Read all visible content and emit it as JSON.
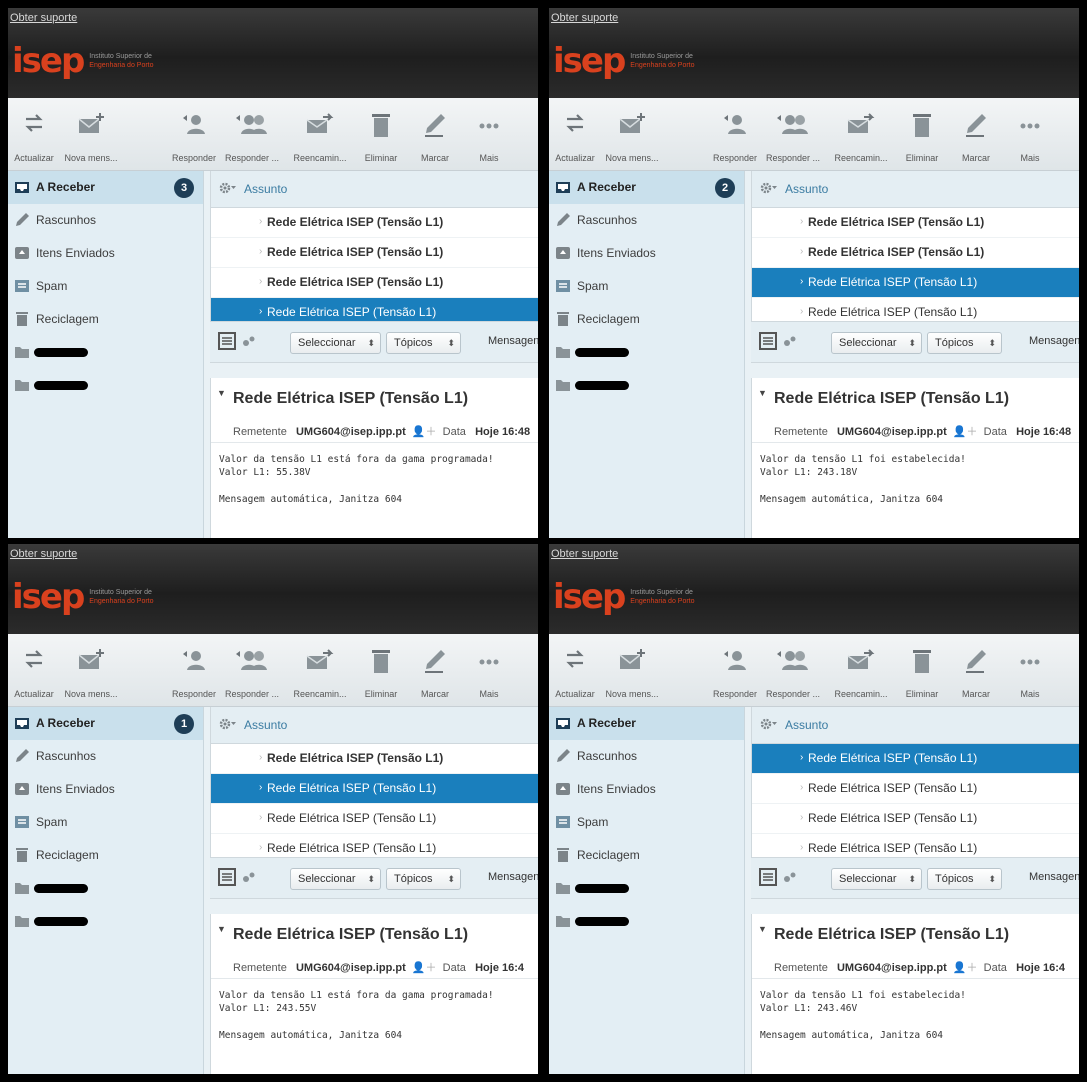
{
  "header": {
    "support_link": "Obter suporte",
    "logo_mark": "isep",
    "logo_line1": "Instituto Superior de",
    "logo_line2": "Engenharia do Porto"
  },
  "toolbar": {
    "refresh": "Actualizar",
    "new_message": "Nova mens...",
    "reply": "Responder",
    "reply_all": "Responder ...",
    "forward": "Reencamin...",
    "delete": "Eliminar",
    "mark": "Marcar",
    "more": "Mais"
  },
  "sidebar": {
    "inbox": "A Receber",
    "drafts": "Rascunhos",
    "sent": "Itens Enviados",
    "spam": "Spam",
    "trash": "Reciclagem"
  },
  "list": {
    "header": "Assunto",
    "subject": "Rede Elétrica ISEP (Tensão L1)",
    "select_label": "Seleccionar",
    "topics_label": "Tópicos",
    "messages_label": "Mensagens"
  },
  "preview": {
    "title": "Rede Elétrica ISEP (Tensão L1)",
    "sender_label": "Remetente",
    "sender": "UMG604@isep.ipp.pt",
    "date_label": "Data",
    "signature": "Mensagem automática, Janitza 604"
  },
  "panels": [
    {
      "inbox_count": "3",
      "date_value": "Hoje 16:48",
      "body_line1": "Valor da tensão L1 está fora da gama programada!",
      "body_line2": "Valor L1: 55.38V",
      "rows": [
        {
          "unread": true,
          "selected": false
        },
        {
          "unread": true,
          "selected": false
        },
        {
          "unread": true,
          "selected": false
        },
        {
          "unread": false,
          "selected": true
        }
      ]
    },
    {
      "inbox_count": "2",
      "date_value": "Hoje 16:48",
      "body_line1": "Valor da tensão L1 foi estabelecida!",
      "body_line2": "Valor L1: 243.18V",
      "rows": [
        {
          "unread": true,
          "selected": false
        },
        {
          "unread": true,
          "selected": false
        },
        {
          "unread": false,
          "selected": true
        },
        {
          "unread": false,
          "selected": false
        }
      ]
    },
    {
      "inbox_count": "1",
      "date_value": "Hoje 16:4",
      "body_line1": "Valor da tensão L1 está fora da gama programada!",
      "body_line2": "Valor L1: 243.55V",
      "rows": [
        {
          "unread": true,
          "selected": false
        },
        {
          "unread": false,
          "selected": true
        },
        {
          "unread": false,
          "selected": false
        },
        {
          "unread": false,
          "selected": false
        }
      ]
    },
    {
      "inbox_count": "",
      "date_value": "Hoje 16:4",
      "body_line1": "Valor da tensão L1 foi estabelecida!",
      "body_line2": "Valor L1: 243.46V",
      "rows": [
        {
          "unread": false,
          "selected": true
        },
        {
          "unread": false,
          "selected": false
        },
        {
          "unread": false,
          "selected": false
        },
        {
          "unread": false,
          "selected": false
        }
      ]
    }
  ],
  "colors": {
    "brand": "#d9411e",
    "selection": "#1a7fbd",
    "badge": "#1e3e57"
  }
}
